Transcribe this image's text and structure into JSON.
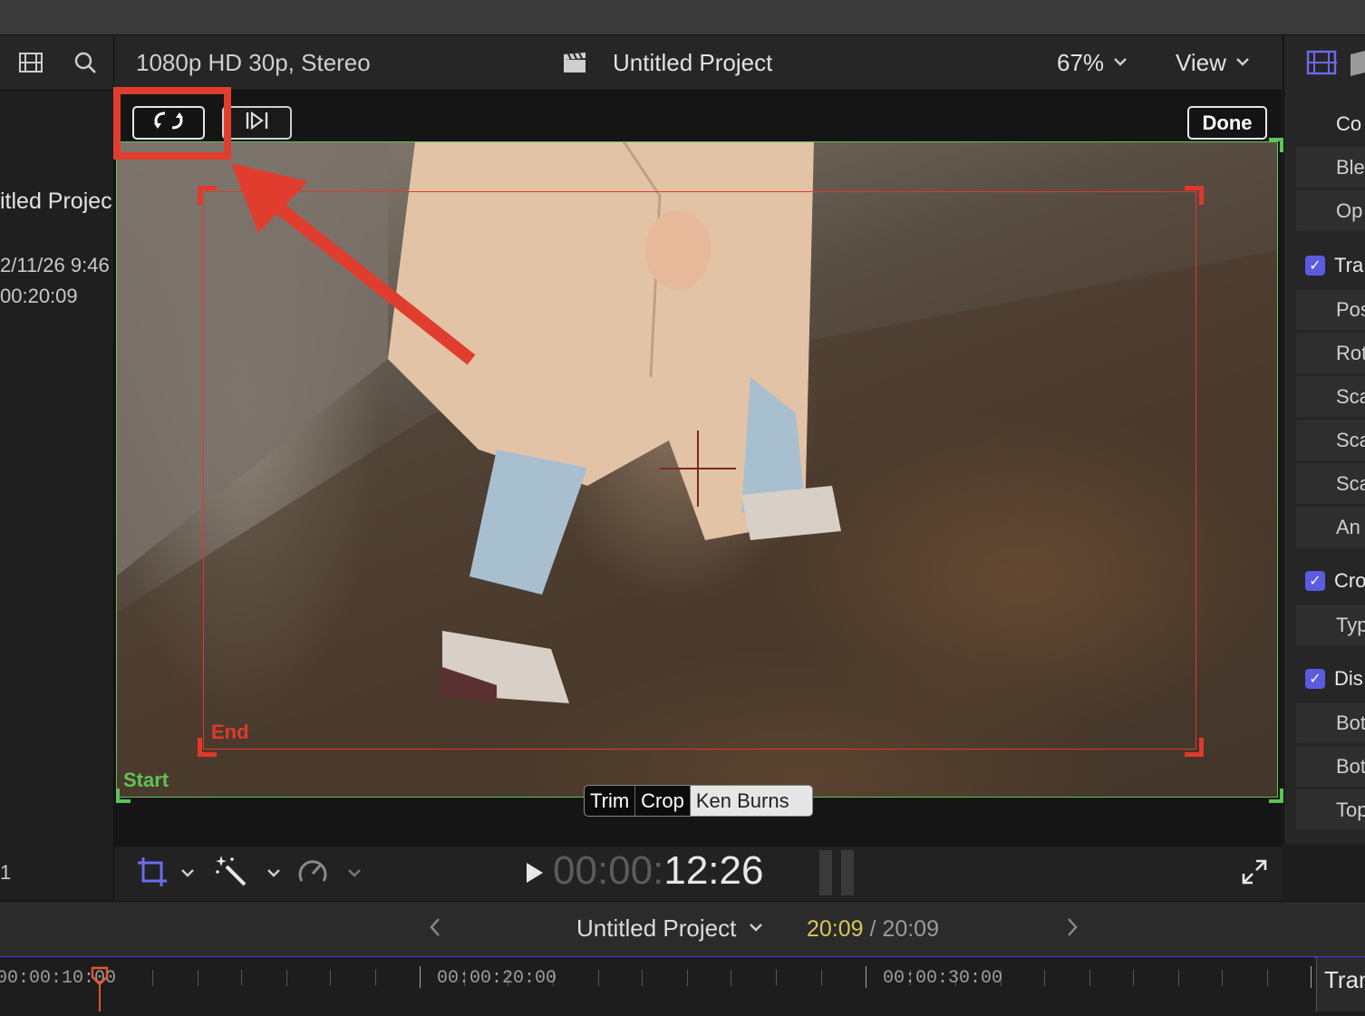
{
  "viewer": {
    "format": "1080p HD 30p, Stereo",
    "project_title": "Untitled Project",
    "zoom": "67%",
    "view_label": "View",
    "done_label": "Done",
    "start_label": "Start",
    "end_label": "End",
    "timecode_dim": "00:00:",
    "timecode_bright": "12:26",
    "modes": [
      "Trim",
      "Crop",
      "Ken Burns"
    ]
  },
  "browser": {
    "clip_name": "itled Projec",
    "date": "2/11/26 9:46",
    "duration": "00:20:09",
    "count": "1"
  },
  "inspector": {
    "rows": [
      "Co",
      "Ble",
      "Op",
      "Tra",
      "Pos",
      "Rot",
      "Sca",
      "Sca",
      "Sca",
      "An",
      "Cro",
      "Typ",
      "Dis",
      "Bot",
      "Bot",
      "Top"
    ]
  },
  "timeline": {
    "project_title": "Untitled Project",
    "current": "20:09",
    "separator": "/",
    "total": "20:09",
    "ruler_labels": [
      "00:00:10:00",
      "00:00:20:00",
      "00:00:30:00"
    ],
    "right_label": "Tran"
  },
  "colors": {
    "accent_red": "#e13d2e",
    "start_green": "#5fc25a",
    "checkbox_blue": "#5b5be0",
    "timecode_yellow": "#d7c65a"
  }
}
